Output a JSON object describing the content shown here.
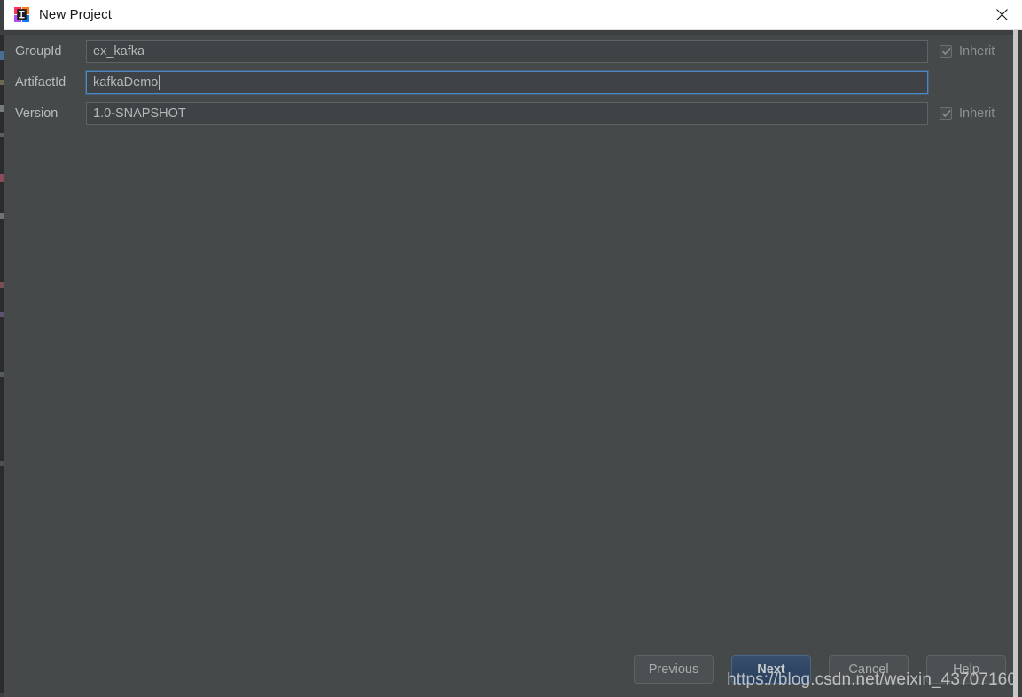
{
  "window": {
    "title": "New Project",
    "app_icon": "intellij-idea-icon",
    "close_icon": "close-icon"
  },
  "colors": {
    "titlebar_bg": "#ffffff",
    "dialog_bg": "#45494a",
    "input_bg": "#3f4345",
    "input_border": "#5e6364",
    "focus_border": "#4a88c7",
    "label_text": "#b9bcbd",
    "default_button_bg": "#2f4764",
    "frame_border": "#c8c8c8"
  },
  "form": {
    "fields": [
      {
        "label": "GroupId",
        "value": "ex_kafka",
        "focused": false,
        "has_inherit": true,
        "inherit_label": "Inherit",
        "inherit_checked": true,
        "inherit_enabled": false
      },
      {
        "label": "ArtifactId",
        "value": "kafkaDemo",
        "focused": true,
        "has_inherit": false,
        "inherit_label": "",
        "inherit_checked": false,
        "inherit_enabled": false
      },
      {
        "label": "Version",
        "value": "1.0-SNAPSHOT",
        "focused": false,
        "has_inherit": true,
        "inherit_label": "Inherit",
        "inherit_checked": true,
        "inherit_enabled": false
      }
    ]
  },
  "buttons": [
    {
      "label": "Previous",
      "name": "previous-button",
      "default": false
    },
    {
      "label": "Next",
      "name": "next-button",
      "default": true
    },
    {
      "label": "Cancel",
      "name": "cancel-button",
      "default": false
    },
    {
      "label": "Help",
      "name": "help-button",
      "default": false
    }
  ],
  "watermark": {
    "text": "https://blog.csdn.net/weixin_43707160"
  }
}
